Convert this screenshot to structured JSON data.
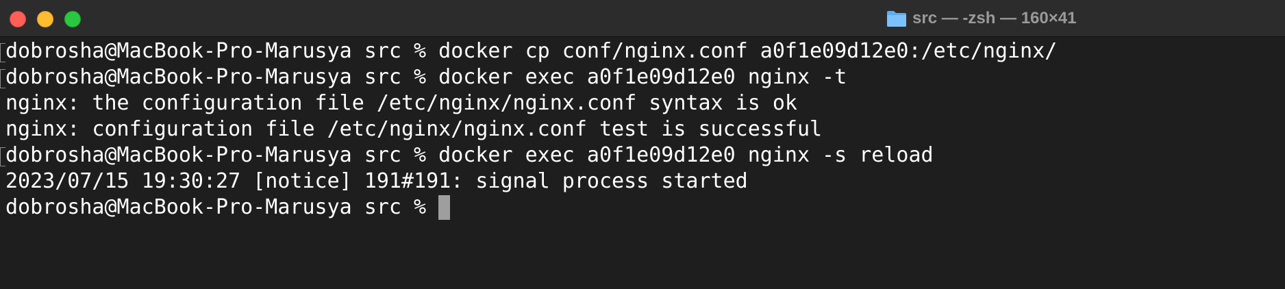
{
  "window": {
    "title": "src — -zsh — 160×41",
    "title_icon": "folder-icon",
    "colors": {
      "close": "#fe5f57",
      "minimize": "#febc2e",
      "zoom": "#28c840",
      "background": "#1e1e1e",
      "text": "#ffffff"
    }
  },
  "terminal": {
    "lines": [
      {
        "text": "dobrosha@MacBook-Pro-Marusya src % docker cp conf/nginx.conf a0f1e09d12e0:/etc/nginx/",
        "marked": true
      },
      {
        "text": "dobrosha@MacBook-Pro-Marusya src % docker exec a0f1e09d12e0 nginx -t",
        "marked": true
      },
      {
        "text": "nginx: the configuration file /etc/nginx/nginx.conf syntax is ok",
        "marked": false
      },
      {
        "text": "nginx: configuration file /etc/nginx/nginx.conf test is successful",
        "marked": false
      },
      {
        "text": "dobrosha@MacBook-Pro-Marusya src % docker exec a0f1e09d12e0 nginx -s reload",
        "marked": true
      },
      {
        "text": "2023/07/15 19:30:27 [notice] 191#191: signal process started",
        "marked": false
      }
    ],
    "prompt": "dobrosha@MacBook-Pro-Marusya src % "
  }
}
